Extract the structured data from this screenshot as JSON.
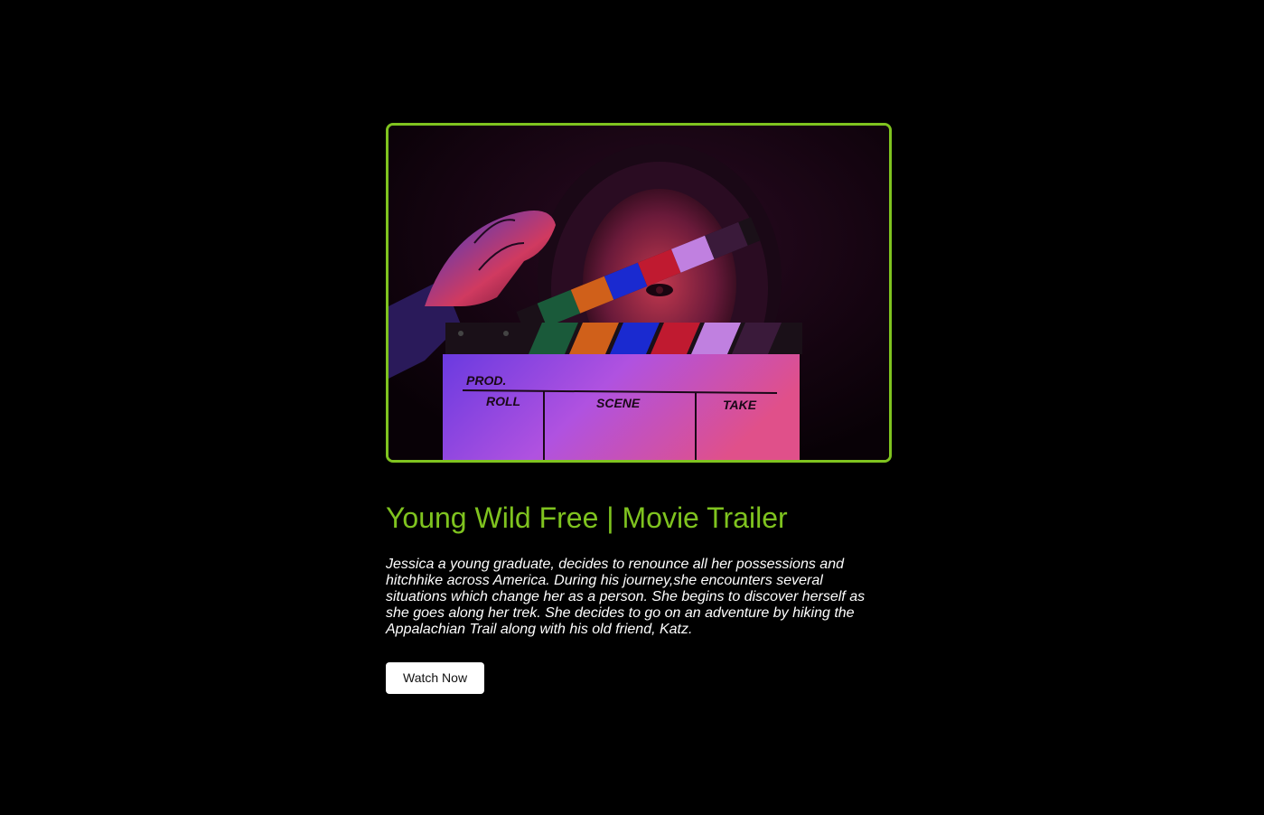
{
  "hero": {
    "image_alt": "Woman holding a movie clapperboard in neon light",
    "clapper_labels": {
      "prod": "PROD.",
      "roll": "ROLL",
      "scene": "SCENE",
      "take": "TAKE"
    }
  },
  "movie": {
    "title": "Young Wild Free | Movie Trailer",
    "description": "Jessica a young graduate, decides to renounce all her possessions and hitchhike across America. During his journey,she encounters several situations which change her as a person. She begins to discover herself as she goes along her trek. She decides to go on an adventure by hiking the Appalachian Trail along with his old friend, Katz."
  },
  "actions": {
    "watch_label": "Watch Now"
  },
  "colors": {
    "accent": "#7fc31f",
    "background": "#000000",
    "text": "#ffffff",
    "button_bg": "#ffffff"
  }
}
